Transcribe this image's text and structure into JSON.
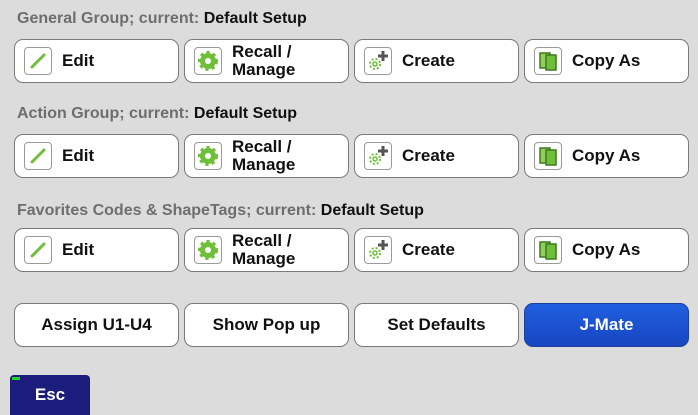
{
  "groups": [
    {
      "title_prefix": "General Group; current: ",
      "current": "Default Setup",
      "buttons": {
        "edit": "Edit",
        "recall_line1": "Recall /",
        "recall_line2": "Manage",
        "create": "Create",
        "copy_as": "Copy As"
      }
    },
    {
      "title_prefix": "Action Group; current: ",
      "current": "Default Setup",
      "buttons": {
        "edit": "Edit",
        "recall_line1": "Recall /",
        "recall_line2": "Manage",
        "create": "Create",
        "copy_as": "Copy As"
      }
    },
    {
      "title_prefix": "Favorites Codes & ShapeTags; current: ",
      "current": "Default Setup",
      "buttons": {
        "edit": "Edit",
        "recall_line1": "Recall /",
        "recall_line2": "Manage",
        "create": "Create",
        "copy_as": "Copy As"
      }
    }
  ],
  "bottom": {
    "assign": "Assign U1-U4",
    "popup": "Show Pop up",
    "defaults": "Set Defaults",
    "jmate": "J-Mate"
  },
  "esc": "Esc",
  "icons": {
    "edit": "pencil-icon",
    "recall": "gear-icon",
    "create": "gear-plus-icon",
    "copy_as": "copy-pages-icon"
  },
  "colors": {
    "background": "#dcdcdc",
    "title_gray": "#6e6e6e",
    "accent_blue": "#1f5fe0",
    "esc_navy": "#1c1c7c",
    "icon_green": "#6fbf3a"
  }
}
